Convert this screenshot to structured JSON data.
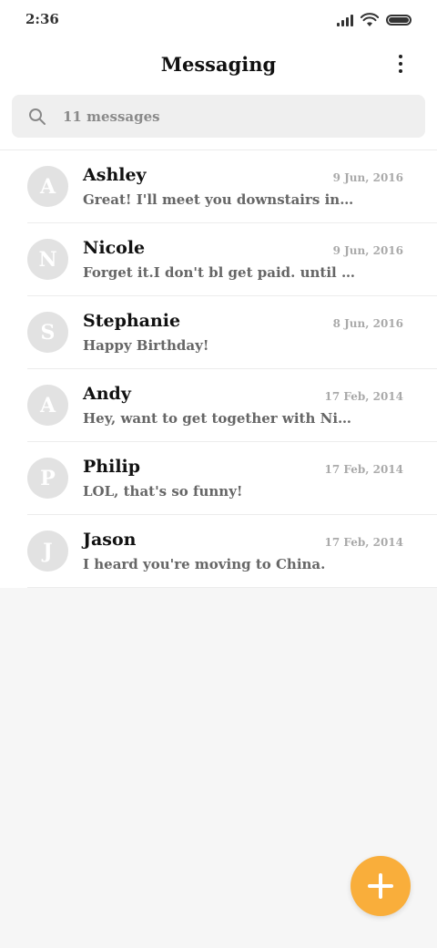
{
  "status_bar": {
    "time": "2:36",
    "icons": [
      "signal-icon",
      "wifi-icon",
      "battery-icon"
    ]
  },
  "header": {
    "title": "Messaging",
    "menu_icon": "more-vertical-icon"
  },
  "search": {
    "placeholder": "11 messages",
    "icon": "search-icon"
  },
  "messages": [
    {
      "initial": "A",
      "name": "Ashley",
      "date": "9 Jun, 2016",
      "preview": "Great! I'll meet you downstairs in ten minutes."
    },
    {
      "initial": "N",
      "name": "Nicole",
      "date": "9 Jun, 2016",
      "preview": "Forget it.I don't bl get paid. until next Friday."
    },
    {
      "initial": "S",
      "name": "Stephanie",
      "date": "8 Jun, 2016",
      "preview": "Happy Birthday!"
    },
    {
      "initial": "A",
      "name": "Andy",
      "date": "17 Feb, 2014",
      "preview": "Hey, want to get together with Nicole on Friday?"
    },
    {
      "initial": "P",
      "name": "Philip",
      "date": "17 Feb, 2014",
      "preview": "LOL, that's so funny!"
    },
    {
      "initial": "J",
      "name": "Jason",
      "date": "17 Feb, 2014",
      "preview": "I heard you're moving to China."
    }
  ],
  "fab": {
    "icon": "plus-icon"
  },
  "colors": {
    "accent": "#f9ae3b",
    "avatar_bg": "#e2e2e2",
    "page_bg": "#f6f6f6"
  }
}
